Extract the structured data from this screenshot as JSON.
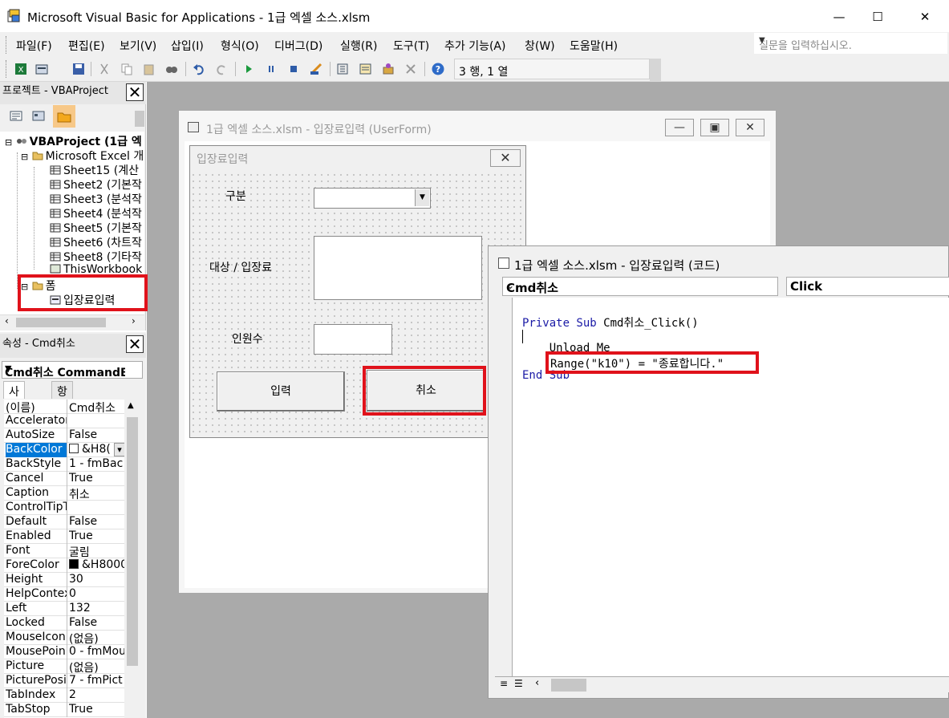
{
  "window": {
    "title": "Microsoft Visual Basic for Applications - 1급 엑셀 소스.xlsm",
    "minimize": "—",
    "maximize": "☐",
    "close": "✕"
  },
  "menu": {
    "items": [
      "파일(F)",
      "편집(E)",
      "보기(V)",
      "삽입(I)",
      "형식(O)",
      "디버그(D)",
      "실행(R)",
      "도구(T)",
      "추가 기능(A)",
      "창(W)",
      "도움말(H)"
    ],
    "help_placeholder": "질문을 입력하십시오."
  },
  "toolbar": {
    "position": "3 행, 1 열"
  },
  "project": {
    "header": "프로젝트 - VBAProject",
    "root": "VBAProject (1급 엑",
    "excel_folder": "Microsoft Excel 개",
    "sheets": [
      "Sheet15 (계산",
      "Sheet2 (기본작",
      "Sheet3 (분석작",
      "Sheet4 (분석작",
      "Sheet5 (기본작",
      "Sheet6 (차트작",
      "Sheet8 (기타작",
      "ThisWorkbook"
    ],
    "forms_folder": "폼",
    "form_item": "입장료입력"
  },
  "properties": {
    "header": "속성 - Cmd취소",
    "object": "Cmd취소 CommandBu",
    "tab_alpha": "사전순",
    "tab_category": "항목별",
    "rows": [
      {
        "key": "(이름)",
        "value": "Cmd취소"
      },
      {
        "key": "Accelerator",
        "value": ""
      },
      {
        "key": "AutoSize",
        "value": "False"
      },
      {
        "key": "BackColor",
        "value": "&H8("
      },
      {
        "key": "BackStyle",
        "value": "1 - fmBac"
      },
      {
        "key": "Cancel",
        "value": "True"
      },
      {
        "key": "Caption",
        "value": "취소"
      },
      {
        "key": "ControlTipT",
        "value": ""
      },
      {
        "key": "Default",
        "value": "False"
      },
      {
        "key": "Enabled",
        "value": "True"
      },
      {
        "key": "Font",
        "value": "굴림"
      },
      {
        "key": "ForeColor",
        "value": "&H8000"
      },
      {
        "key": "Height",
        "value": "30"
      },
      {
        "key": "HelpContex",
        "value": "0"
      },
      {
        "key": "Left",
        "value": "132"
      },
      {
        "key": "Locked",
        "value": "False"
      },
      {
        "key": "MouseIcon",
        "value": "(없음)"
      },
      {
        "key": "MousePoin",
        "value": "0 - fmMou"
      },
      {
        "key": "Picture",
        "value": "(없음)"
      },
      {
        "key": "PicturePosi",
        "value": "7 - fmPict"
      },
      {
        "key": "TabIndex",
        "value": "2"
      },
      {
        "key": "TabStop",
        "value": "True"
      }
    ]
  },
  "userform_window": {
    "title": "1급 엑셀 소스.xlsm - 입장료입력 (UserForm)",
    "form_caption": "입장료입력",
    "label_category": "구분",
    "label_target": "대상 / 입장료",
    "label_count": "인원수",
    "button_input": "입력",
    "button_cancel": "취소"
  },
  "code_window": {
    "title": "1급 엑셀 소스.xlsm - 입장료입력 (코드)",
    "object_combo": "Cmd취소",
    "proc_combo": "Click",
    "lines": {
      "l1_kw": "Private Sub",
      "l1_rest": " Cmd취소_Click()",
      "l2": "    Unload Me",
      "l3": "Range(\"k10\") = \"종료합니다.\"",
      "l4_kw": "End Sub"
    }
  },
  "colors": {
    "highlight": "#e0121b",
    "keyword": "#1a1aa6",
    "workspace": "#aaaaaa"
  }
}
